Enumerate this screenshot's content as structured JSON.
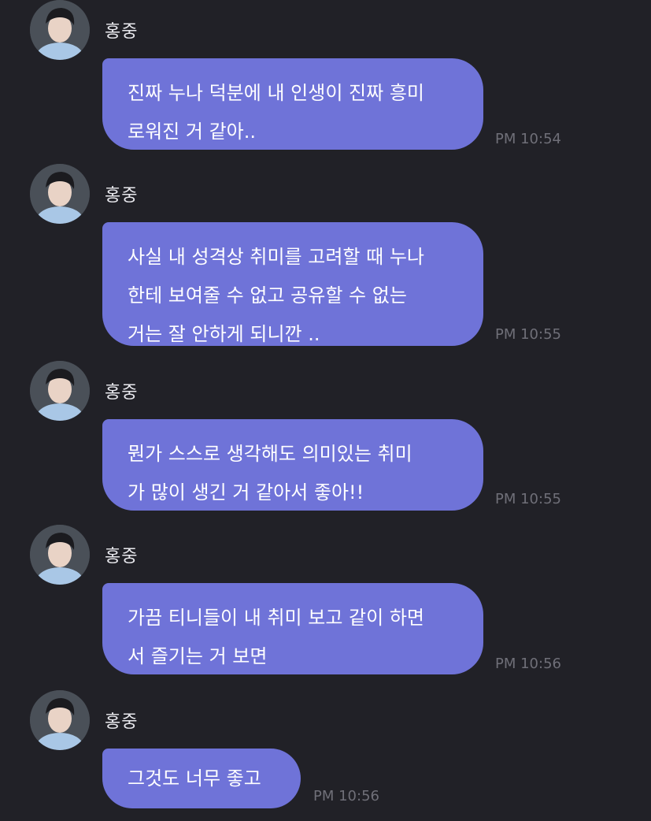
{
  "conversation": {
    "messages": [
      {
        "sender": "홍중",
        "lines": [
          "진짜 누나 덕분에 내 인생이 진짜 흥미",
          "로워진 거 같아.."
        ],
        "time": "PM 10:54"
      },
      {
        "sender": "홍중",
        "lines": [
          "사실 내 성격상 취미를 고려할 때 누나",
          "한테 보여줄 수 없고 공유할 수 없는",
          "거는 잘 안하게 되니깐 .."
        ],
        "time": "PM 10:55"
      },
      {
        "sender": "홍중",
        "lines": [
          "뭔가 스스로 생각해도 의미있는 취미",
          "가 많이 생긴 거 같아서 좋아!!"
        ],
        "time": "PM 10:55"
      },
      {
        "sender": "홍중",
        "lines": [
          "가끔 티니들이 내 취미 보고 같이 하면",
          "서 즐기는 거 보면"
        ],
        "time": "PM 10:56"
      },
      {
        "sender": "홍중",
        "lines": [
          "그것도 너무 좋고"
        ],
        "time": "PM 10:56"
      }
    ]
  },
  "colors": {
    "background": "#212127",
    "bubble": "#6f73d8",
    "bubble_text": "#ffffff",
    "sender_text": "#e9e9ee",
    "time_text": "#6f6f78"
  }
}
